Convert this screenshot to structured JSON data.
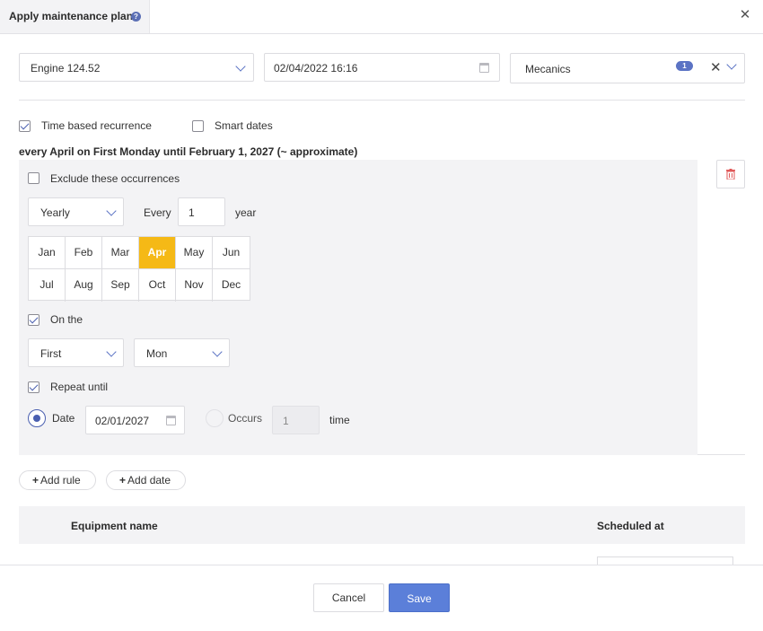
{
  "dialog": {
    "title": "Apply maintenance plan",
    "help_icon": "help-circle-icon",
    "close_icon": "close-icon"
  },
  "top_fields": {
    "equipment": "Engine 124.52",
    "datetime": "02/04/2022 16:16",
    "team": "Mecanics",
    "team_count": "1"
  },
  "options": {
    "time_based_label": "Time based recurrence",
    "time_based_checked": true,
    "smart_dates_label": "Smart dates",
    "smart_dates_checked": false
  },
  "summary": "every April on First Monday until February 1, 2027 (~ approximate)",
  "rule": {
    "exclude_label": "Exclude these occurrences",
    "exclude_checked": false,
    "frequency": "Yearly",
    "every_label": "Every",
    "every_value": "1",
    "unit_label": "year",
    "months": [
      "Jan",
      "Feb",
      "Mar",
      "Apr",
      "May",
      "Jun",
      "Jul",
      "Aug",
      "Sep",
      "Oct",
      "Nov",
      "Dec"
    ],
    "selected_month": "Apr",
    "on_the_label": "On the",
    "on_the_checked": true,
    "ordinal": "First",
    "weekday": "Mon",
    "repeat_until_label": "Repeat until",
    "repeat_until_checked": true,
    "date_label": "Date",
    "date_value": "02/01/2027",
    "occurs_label": "Occurs",
    "occurs_value": "1",
    "time_label": "time"
  },
  "actions": {
    "add_rule": "Add rule",
    "add_date": "Add date"
  },
  "table": {
    "columns": [
      "Equipment name",
      "Scheduled at"
    ]
  },
  "footer": {
    "cancel": "Cancel",
    "save": "Save"
  },
  "colors": {
    "accent": "#5b73c4",
    "selected_month": "#f5b916",
    "save_button": "#5b7fd9",
    "delete_icon": "#e05a5a"
  }
}
